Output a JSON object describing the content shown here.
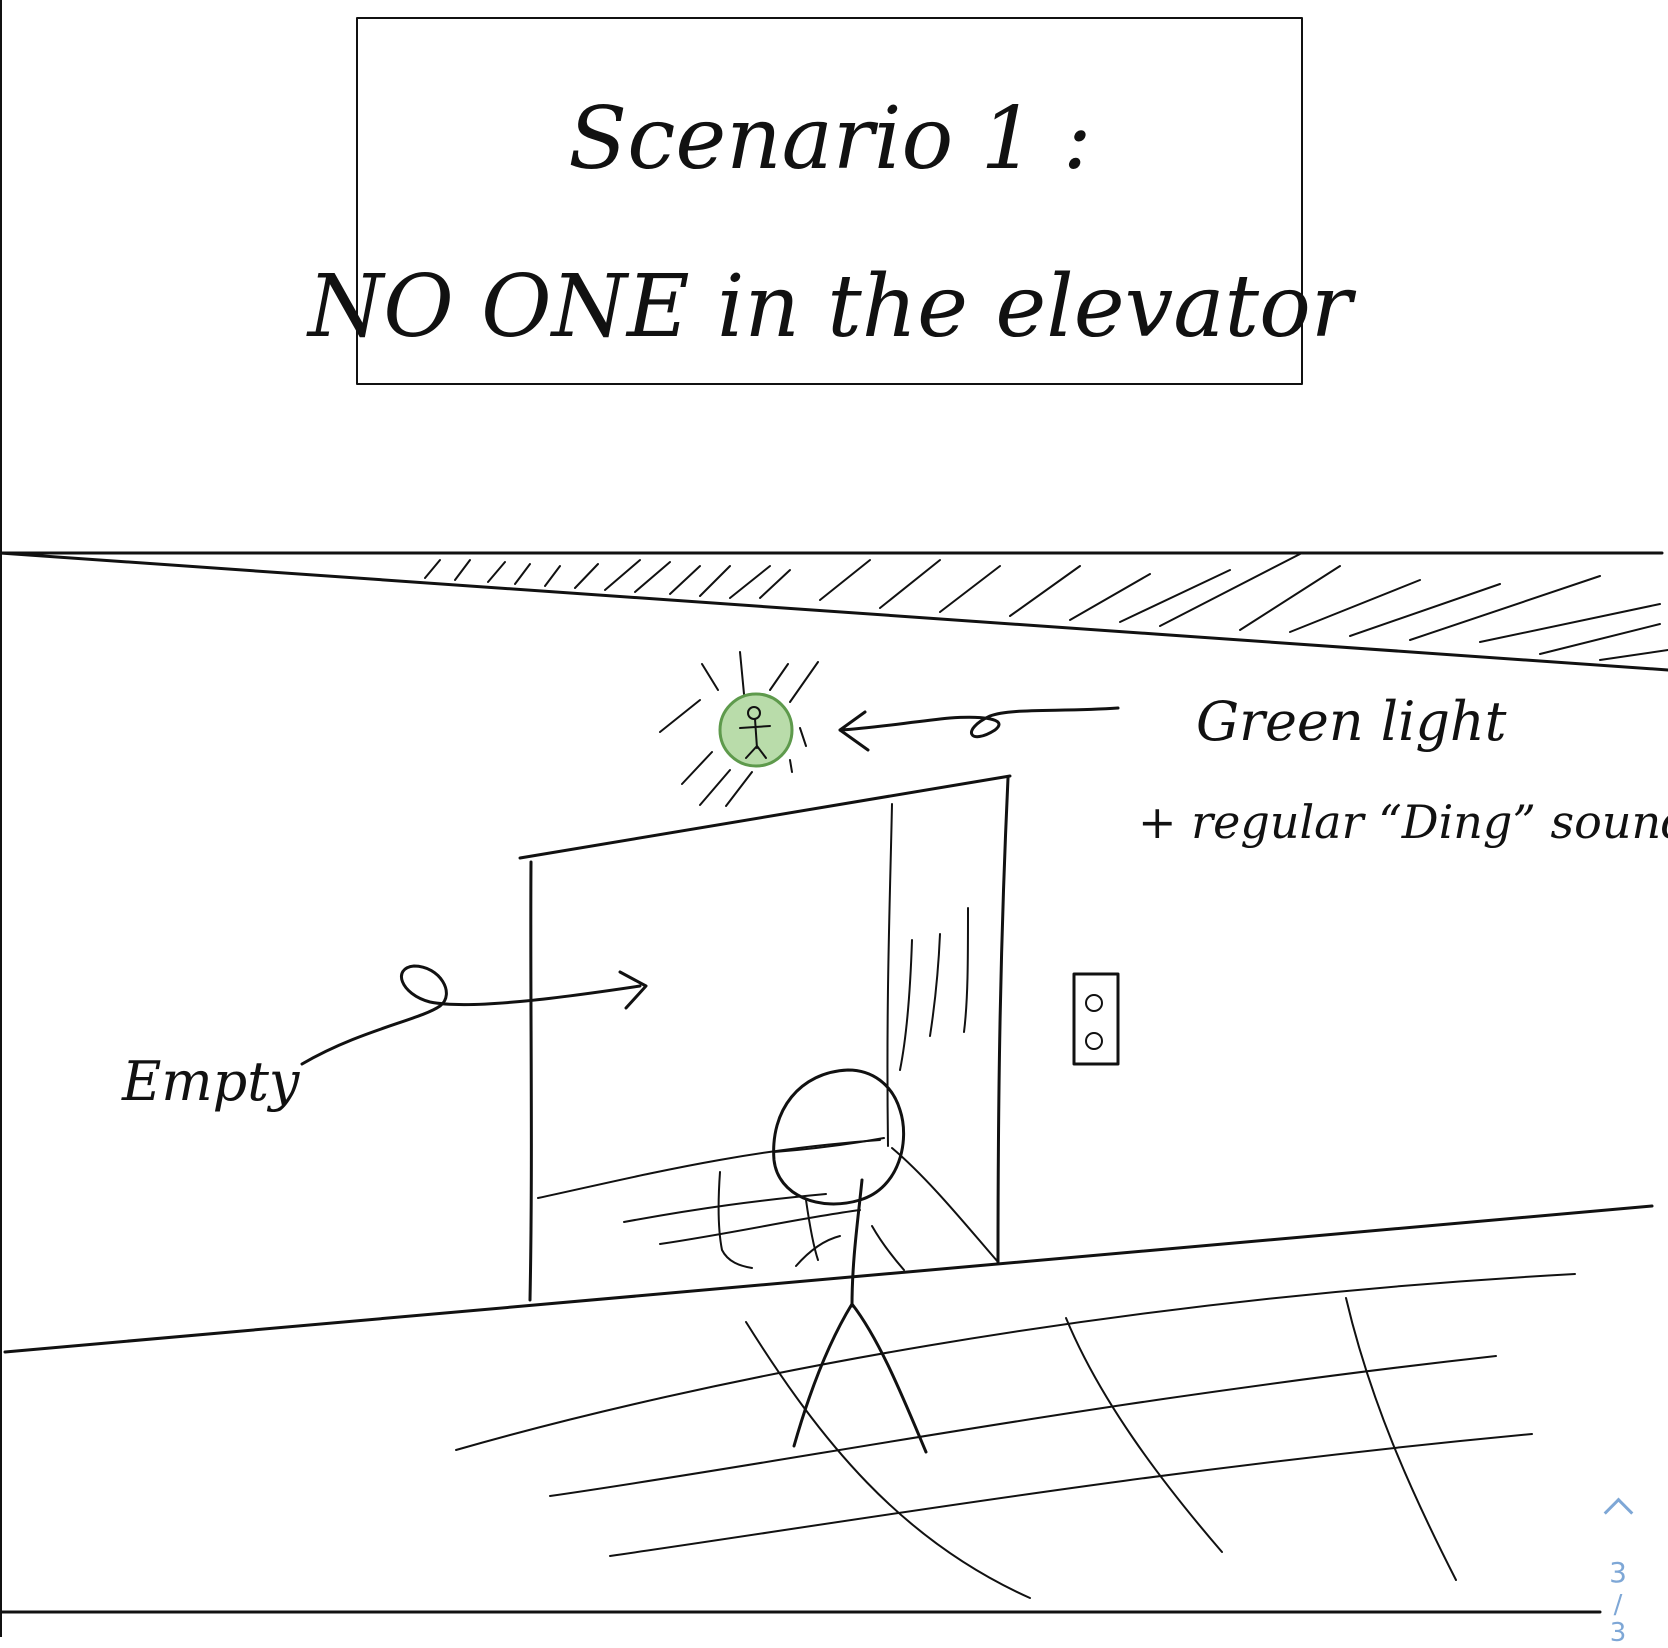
{
  "title_box": {
    "line1": "Scenario 1 :",
    "line2": "NO ONE in the elevator"
  },
  "annotations": {
    "green_light": "Green light",
    "ding_sound": "+ regular “Ding” sound .",
    "empty": "Empty"
  },
  "colors": {
    "indicator_green": "#b9dcaa",
    "indicator_stroke": "#5e9a4c",
    "pager_accent": "#7ea7d6"
  },
  "pager": {
    "current": "3",
    "separator": "/",
    "total": "3"
  }
}
